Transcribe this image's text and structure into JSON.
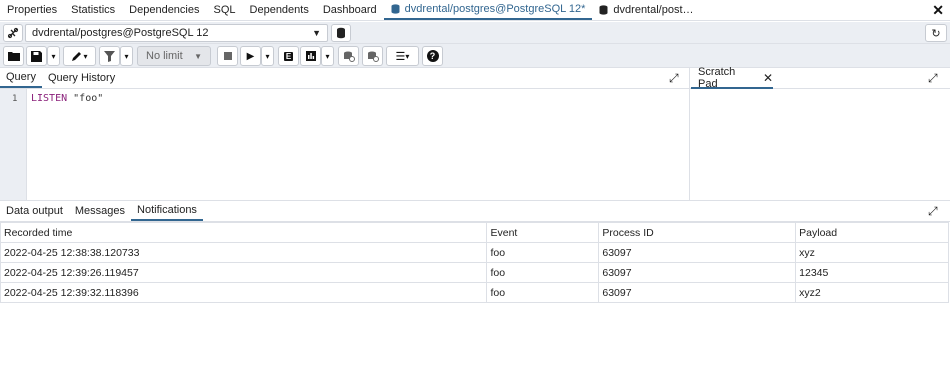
{
  "top_tabs": [
    "Properties",
    "Statistics",
    "Dependencies",
    "SQL",
    "Dependents",
    "Dashboard"
  ],
  "active_tab": "dvdrental/postgres@PostgreSQL 12*",
  "other_tab": "dvdrental/post…",
  "connection": "dvdrental/postgres@PostgreSQL 12",
  "limit_label": "No limit",
  "editor_tabs": [
    "Query",
    "Query History"
  ],
  "scratch_pad": "Scratch Pad",
  "code": {
    "line_no": "1",
    "keyword": "LISTEN",
    "string": "\"foo\""
  },
  "result_tabs": [
    "Data output",
    "Messages",
    "Notifications"
  ],
  "columns": [
    "Recorded time",
    "Event",
    "Process ID",
    "Payload"
  ],
  "rows": [
    [
      "2022-04-25 12:38:38.120733",
      "foo",
      "63097",
      "xyz"
    ],
    [
      "2022-04-25 12:39:26.119457",
      "foo",
      "63097",
      "12345"
    ],
    [
      "2022-04-25 12:39:32.118396",
      "foo",
      "63097",
      "xyz2"
    ]
  ],
  "colors": {
    "accent": "#326690",
    "toolbar_bg": "#ebeef3",
    "keyword": "#8a1f7a"
  },
  "icons": [
    "close-icon",
    "database-icon",
    "disconnect-icon",
    "refresh-icon",
    "folder-icon",
    "save-icon",
    "edit-icon",
    "filter-icon",
    "stop-icon",
    "play-icon",
    "explain-icon",
    "chart-icon",
    "commit-icon",
    "rollback-icon",
    "macros-icon",
    "help-icon",
    "expand-icon"
  ]
}
